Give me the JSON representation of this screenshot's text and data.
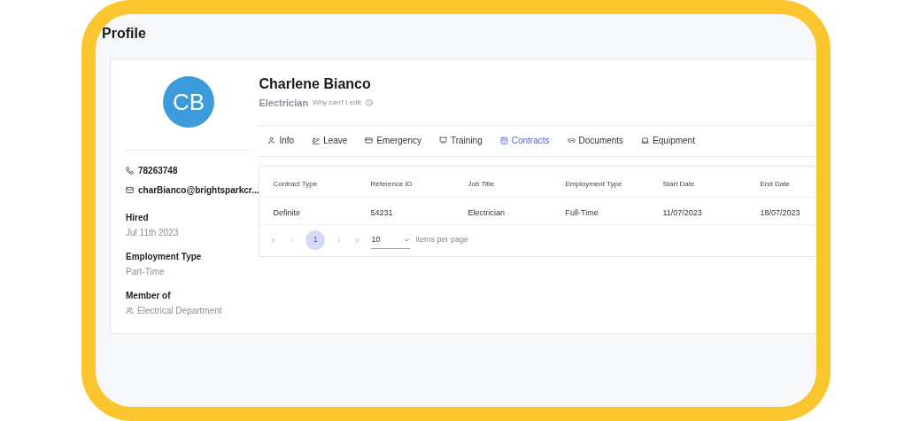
{
  "page_title": "Profile",
  "profile": {
    "initials": "CB",
    "name": "Charlene Bianco",
    "role": "Electrician",
    "edit_hint": "Why can't I edit",
    "phone": "78263748",
    "email": "charBianco@brightsparkcr...",
    "details": [
      {
        "label": "Hired",
        "value": "Jul 11th 2023"
      },
      {
        "label": "Employment Type",
        "value": "Part-Time"
      },
      {
        "label": "Member of",
        "value": "Electrical Department",
        "kind": "group"
      }
    ]
  },
  "tabs": [
    {
      "label": "Info",
      "selected": false
    },
    {
      "label": "Leave",
      "selected": false
    },
    {
      "label": "Emergency",
      "selected": false
    },
    {
      "label": "Training",
      "selected": false
    },
    {
      "label": "Contracts",
      "selected": true
    },
    {
      "label": "Documents",
      "selected": false
    },
    {
      "label": "Equipment",
      "selected": false
    }
  ],
  "table": {
    "columns": [
      "Contract Type",
      "Reference ID",
      "Job Title",
      "Employment Type",
      "Start Date",
      "End Date"
    ],
    "rows": [
      [
        "Definite",
        "54231",
        "Electrician",
        "Full-Time",
        "11/07/2023",
        "18/07/2023"
      ]
    ]
  },
  "pagination": {
    "pages": [
      {
        "label": "1",
        "selected": true
      }
    ],
    "page_size": "10",
    "page_size_label": "items per page"
  }
}
